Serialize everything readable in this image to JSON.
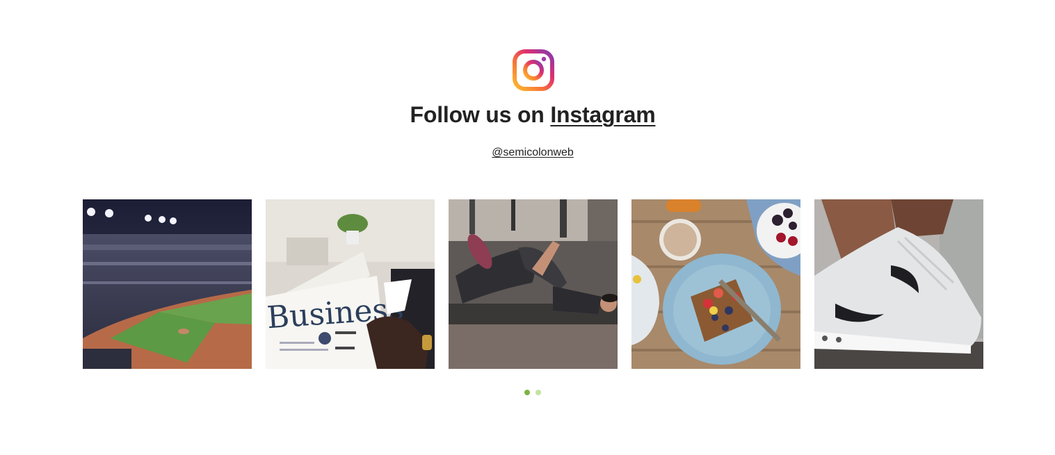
{
  "header": {
    "logo_icon": "instagram-logo-icon",
    "title_prefix": "Follow us on",
    "title_link": "Instagram",
    "handle": "@semicolonweb"
  },
  "gallery": {
    "items": [
      {
        "icon": "baseball-stadium-photo"
      },
      {
        "icon": "business-newspaper-photo"
      },
      {
        "icon": "gym-stretching-photo"
      },
      {
        "icon": "breakfast-plate-photo"
      },
      {
        "icon": "sneaker-photo"
      }
    ]
  },
  "pagination": {
    "pages": 2,
    "active_index": 0,
    "active_color": "#7cb342",
    "inactive_color": "#c5e1a5"
  },
  "colors": {
    "text": "#222222",
    "background": "#ffffff"
  }
}
